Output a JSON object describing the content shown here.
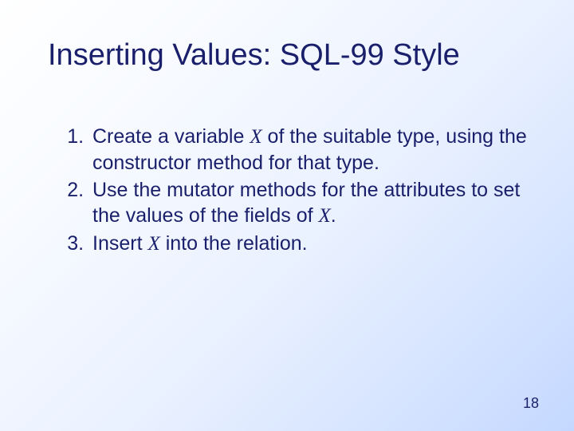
{
  "title": "Inserting Values: SQL-99 Style",
  "items": [
    {
      "pre": "Create a variable ",
      "var": "X",
      "post": "  of the suitable type, using the constructor method for that type."
    },
    {
      "pre": "Use the mutator methods for the attributes to set the values of the fields of ",
      "var": "X",
      "post": "."
    },
    {
      "pre": "Insert ",
      "var": "X",
      "post": "  into the relation."
    }
  ],
  "page_number": "18"
}
